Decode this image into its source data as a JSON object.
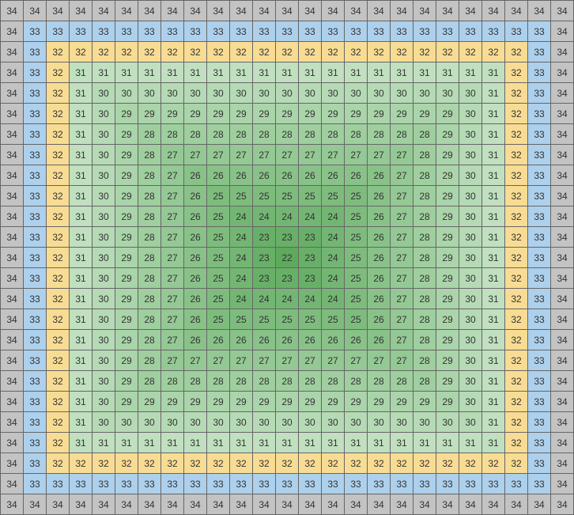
{
  "chart_data": {
    "type": "heatmap",
    "title": "",
    "xlabel": "",
    "ylabel": "",
    "rows": 25,
    "cols": 25,
    "value_min": 22,
    "value_max": 34,
    "pattern": "concentric Chebyshev distance + 22, clamped at 34",
    "colors": {
      "22": "#5DAA5D",
      "23": "#68B068",
      "24": "#73B673",
      "25": "#7EBC7E",
      "26": "#89C289",
      "27": "#94C894",
      "28": "#9FCE9F",
      "29": "#AAD4AA",
      "30": "#B5DAB5",
      "31": "#C0E0C0",
      "32": "#F8DC93",
      "33": "#ADD0EC",
      "34": "#C3C3C3"
    },
    "values": [
      [
        34,
        34,
        34,
        34,
        34,
        34,
        34,
        34,
        34,
        34,
        34,
        34,
        34,
        34,
        34,
        34,
        34,
        34,
        34,
        34,
        34,
        34,
        34,
        34,
        34
      ],
      [
        34,
        33,
        33,
        33,
        33,
        33,
        33,
        33,
        33,
        33,
        33,
        33,
        33,
        33,
        33,
        33,
        33,
        33,
        33,
        33,
        33,
        33,
        33,
        33,
        34
      ],
      [
        34,
        33,
        32,
        32,
        32,
        32,
        32,
        32,
        32,
        32,
        32,
        32,
        32,
        32,
        32,
        32,
        32,
        32,
        32,
        32,
        32,
        32,
        32,
        33,
        34
      ],
      [
        34,
        33,
        32,
        31,
        31,
        31,
        31,
        31,
        31,
        31,
        31,
        31,
        31,
        31,
        31,
        31,
        31,
        31,
        31,
        31,
        31,
        31,
        32,
        33,
        34
      ],
      [
        34,
        33,
        32,
        31,
        30,
        30,
        30,
        30,
        30,
        30,
        30,
        30,
        30,
        30,
        30,
        30,
        30,
        30,
        30,
        30,
        30,
        31,
        32,
        33,
        34
      ],
      [
        34,
        33,
        32,
        31,
        30,
        29,
        29,
        29,
        29,
        29,
        29,
        29,
        29,
        29,
        29,
        29,
        29,
        29,
        29,
        29,
        30,
        31,
        32,
        33,
        34
      ],
      [
        34,
        33,
        32,
        31,
        30,
        29,
        28,
        28,
        28,
        28,
        28,
        28,
        28,
        28,
        28,
        28,
        28,
        28,
        28,
        29,
        30,
        31,
        32,
        33,
        34
      ],
      [
        34,
        33,
        32,
        31,
        30,
        29,
        28,
        27,
        27,
        27,
        27,
        27,
        27,
        27,
        27,
        27,
        27,
        27,
        28,
        29,
        30,
        31,
        32,
        33,
        34
      ],
      [
        34,
        33,
        32,
        31,
        30,
        29,
        28,
        27,
        26,
        26,
        26,
        26,
        26,
        26,
        26,
        26,
        26,
        27,
        28,
        29,
        30,
        31,
        32,
        33,
        34
      ],
      [
        34,
        33,
        32,
        31,
        30,
        29,
        28,
        27,
        26,
        25,
        25,
        25,
        25,
        25,
        25,
        25,
        26,
        27,
        28,
        29,
        30,
        31,
        32,
        33,
        34
      ],
      [
        34,
        33,
        32,
        31,
        30,
        29,
        28,
        27,
        26,
        25,
        24,
        24,
        24,
        24,
        24,
        25,
        26,
        27,
        28,
        29,
        30,
        31,
        32,
        33,
        34
      ],
      [
        34,
        33,
        32,
        31,
        30,
        29,
        28,
        27,
        26,
        25,
        24,
        23,
        23,
        23,
        24,
        25,
        26,
        27,
        28,
        29,
        30,
        31,
        32,
        33,
        34
      ],
      [
        34,
        33,
        32,
        31,
        30,
        29,
        28,
        27,
        26,
        25,
        24,
        23,
        22,
        23,
        24,
        25,
        26,
        27,
        28,
        29,
        30,
        31,
        32,
        33,
        34
      ],
      [
        34,
        33,
        32,
        31,
        30,
        29,
        28,
        27,
        26,
        25,
        24,
        23,
        23,
        23,
        24,
        25,
        26,
        27,
        28,
        29,
        30,
        31,
        32,
        33,
        34
      ],
      [
        34,
        33,
        32,
        31,
        30,
        29,
        28,
        27,
        26,
        25,
        24,
        24,
        24,
        24,
        24,
        25,
        26,
        27,
        28,
        29,
        30,
        31,
        32,
        33,
        34
      ],
      [
        34,
        33,
        32,
        31,
        30,
        29,
        28,
        27,
        26,
        25,
        25,
        25,
        25,
        25,
        25,
        25,
        26,
        27,
        28,
        29,
        30,
        31,
        32,
        33,
        34
      ],
      [
        34,
        33,
        32,
        31,
        30,
        29,
        28,
        27,
        26,
        26,
        26,
        26,
        26,
        26,
        26,
        26,
        26,
        27,
        28,
        29,
        30,
        31,
        32,
        33,
        34
      ],
      [
        34,
        33,
        32,
        31,
        30,
        29,
        28,
        27,
        27,
        27,
        27,
        27,
        27,
        27,
        27,
        27,
        27,
        27,
        28,
        29,
        30,
        31,
        32,
        33,
        34
      ],
      [
        34,
        33,
        32,
        31,
        30,
        29,
        28,
        28,
        28,
        28,
        28,
        28,
        28,
        28,
        28,
        28,
        28,
        28,
        28,
        29,
        30,
        31,
        32,
        33,
        34
      ],
      [
        34,
        33,
        32,
        31,
        30,
        29,
        29,
        29,
        29,
        29,
        29,
        29,
        29,
        29,
        29,
        29,
        29,
        29,
        29,
        29,
        30,
        31,
        32,
        33,
        34
      ],
      [
        34,
        33,
        32,
        31,
        30,
        30,
        30,
        30,
        30,
        30,
        30,
        30,
        30,
        30,
        30,
        30,
        30,
        30,
        30,
        30,
        30,
        31,
        32,
        33,
        34
      ],
      [
        34,
        33,
        32,
        31,
        31,
        31,
        31,
        31,
        31,
        31,
        31,
        31,
        31,
        31,
        31,
        31,
        31,
        31,
        31,
        31,
        31,
        31,
        32,
        33,
        34
      ],
      [
        34,
        33,
        32,
        32,
        32,
        32,
        32,
        32,
        32,
        32,
        32,
        32,
        32,
        32,
        32,
        32,
        32,
        32,
        32,
        32,
        32,
        32,
        32,
        33,
        34
      ],
      [
        34,
        33,
        33,
        33,
        33,
        33,
        33,
        33,
        33,
        33,
        33,
        33,
        33,
        33,
        33,
        33,
        33,
        33,
        33,
        33,
        33,
        33,
        33,
        33,
        34
      ],
      [
        34,
        34,
        34,
        34,
        34,
        34,
        34,
        34,
        34,
        34,
        34,
        34,
        34,
        34,
        34,
        34,
        34,
        34,
        34,
        34,
        34,
        34,
        34,
        34,
        34
      ]
    ]
  }
}
